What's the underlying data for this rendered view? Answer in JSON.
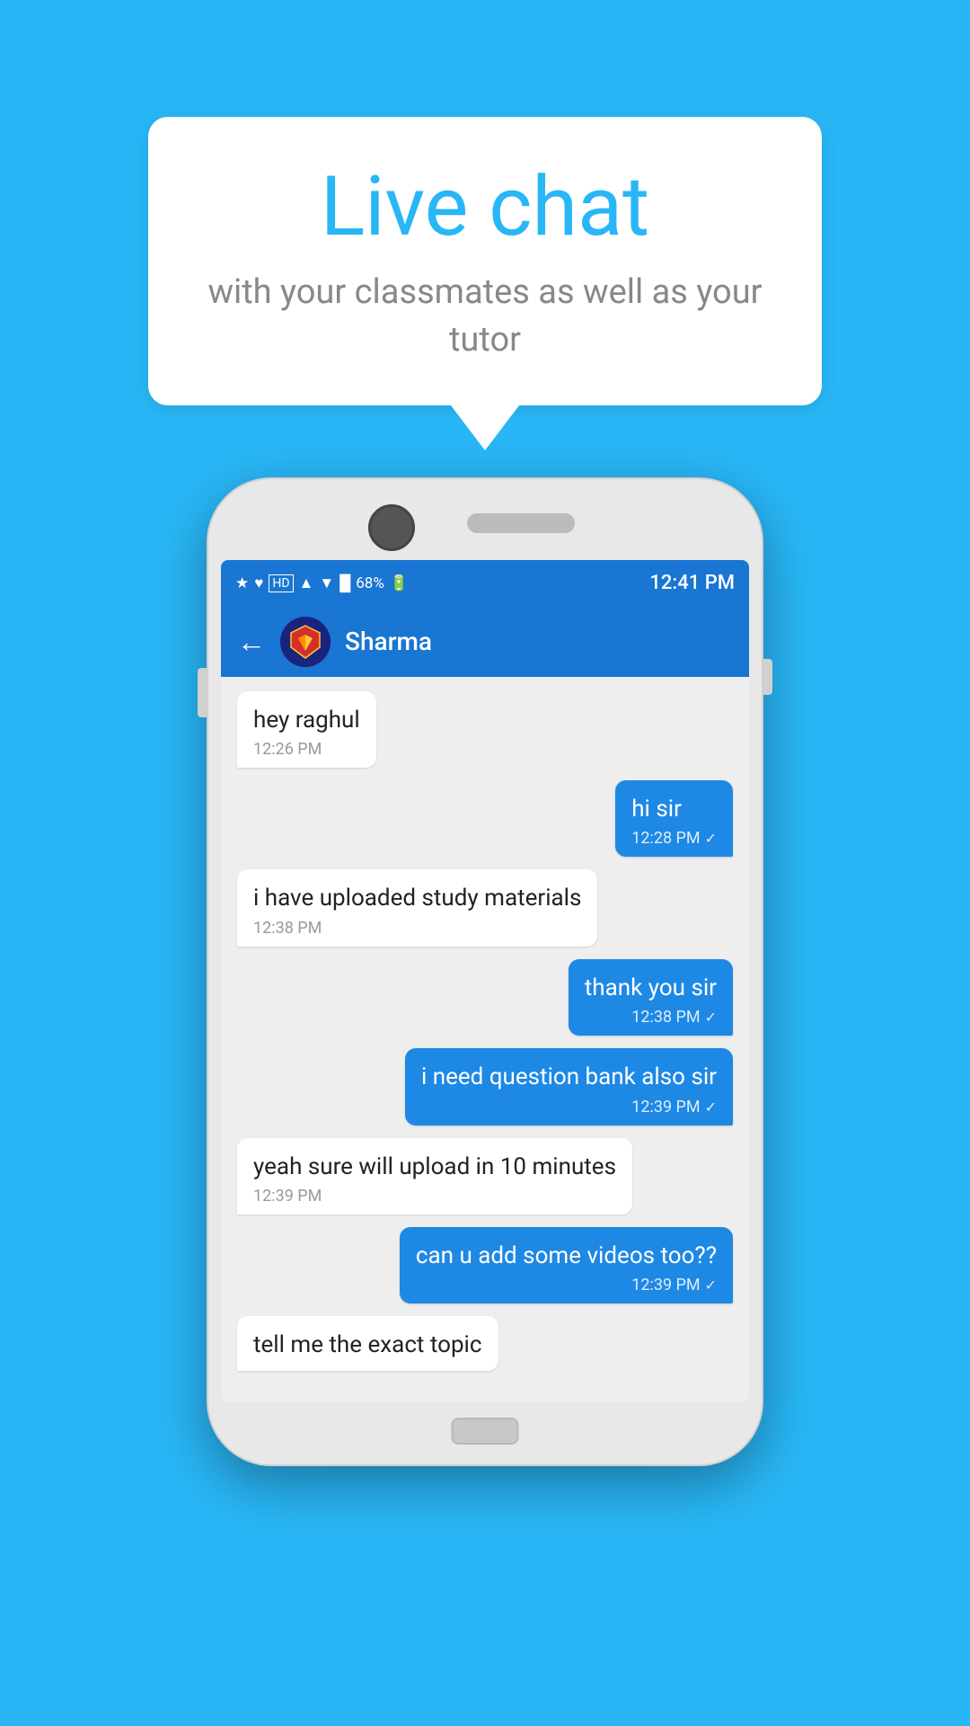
{
  "background_color": "#29b6f6",
  "speech_bubble": {
    "title": "Live chat",
    "subtitle": "with your classmates as well as your tutor"
  },
  "phone": {
    "status_bar": {
      "time": "12:41 PM",
      "battery_percent": "68%",
      "icons": "bluetooth signal hd wifi signal-bars"
    },
    "chat_header": {
      "back_label": "←",
      "contact_name": "Sharma"
    },
    "messages": [
      {
        "id": "msg1",
        "type": "received",
        "text": "hey raghul",
        "time": "12:26 PM"
      },
      {
        "id": "msg2",
        "type": "sent",
        "text": "hi sir",
        "time": "12:28 PM"
      },
      {
        "id": "msg3",
        "type": "received",
        "text": "i have uploaded study materials",
        "time": "12:38 PM"
      },
      {
        "id": "msg4",
        "type": "sent",
        "text": "thank you sir",
        "time": "12:38 PM"
      },
      {
        "id": "msg5",
        "type": "sent",
        "text": "i need question bank also sir",
        "time": "12:39 PM"
      },
      {
        "id": "msg6",
        "type": "received",
        "text": "yeah sure will upload in 10 minutes",
        "time": "12:39 PM"
      },
      {
        "id": "msg7",
        "type": "sent",
        "text": "can u add some videos too??",
        "time": "12:39 PM"
      },
      {
        "id": "msg8",
        "type": "received_partial",
        "text": "tell me the exact topic",
        "time": ""
      }
    ]
  }
}
